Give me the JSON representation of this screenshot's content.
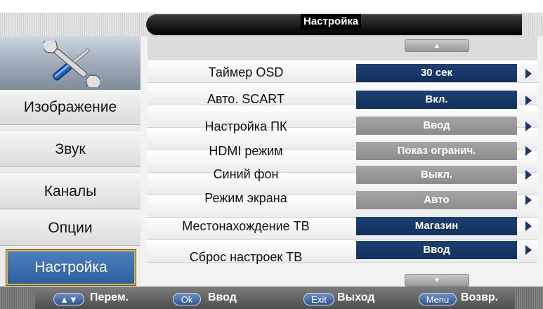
{
  "header": {
    "title": "Настройка"
  },
  "sidebar": {
    "items": [
      {
        "label": "Изображение"
      },
      {
        "label": "Звук"
      },
      {
        "label": "Каналы"
      },
      {
        "label": "Опции"
      },
      {
        "label": "Настройка"
      }
    ]
  },
  "settings": {
    "rows": [
      {
        "label": "Таймер OSD",
        "value": "30 сек",
        "state": "selectable"
      },
      {
        "label": "Авто. SCART",
        "value": "Вкл.",
        "state": "selectable"
      },
      {
        "label": "Настройка ПК",
        "value": "Ввод",
        "state": "disabled"
      },
      {
        "label": "HDMI режим",
        "value": "Показ огранич.",
        "state": "disabled"
      },
      {
        "label": "Синий фон",
        "value": "Выкл.",
        "state": "disabled"
      },
      {
        "label": "Режим экрана",
        "value": "Авто",
        "state": "disabled"
      },
      {
        "label": "Местонахождение ТВ",
        "value": "Магазин",
        "state": "selectable"
      },
      {
        "label": "Сброс настроек ТВ",
        "value": "Ввод",
        "state": "selectable"
      }
    ]
  },
  "footer": {
    "keys": [
      {
        "key": "▲▼",
        "label": "Перем."
      },
      {
        "key": "Ok",
        "label": "Ввод"
      },
      {
        "key": "Exit",
        "label": "Выход"
      },
      {
        "key": "Menu",
        "label": "Возвр."
      }
    ]
  },
  "colors": {
    "accent_blue": "#16396e",
    "disabled_gray": "#9a9a9a",
    "active_item": "#3d6fb0",
    "active_border": "#d9b44a"
  },
  "icons": {
    "logo": "tools-icon",
    "scroll_up": "scroll-up-icon",
    "scroll_down": "scroll-down-icon",
    "row_arrow": "chevron-right-icon"
  }
}
